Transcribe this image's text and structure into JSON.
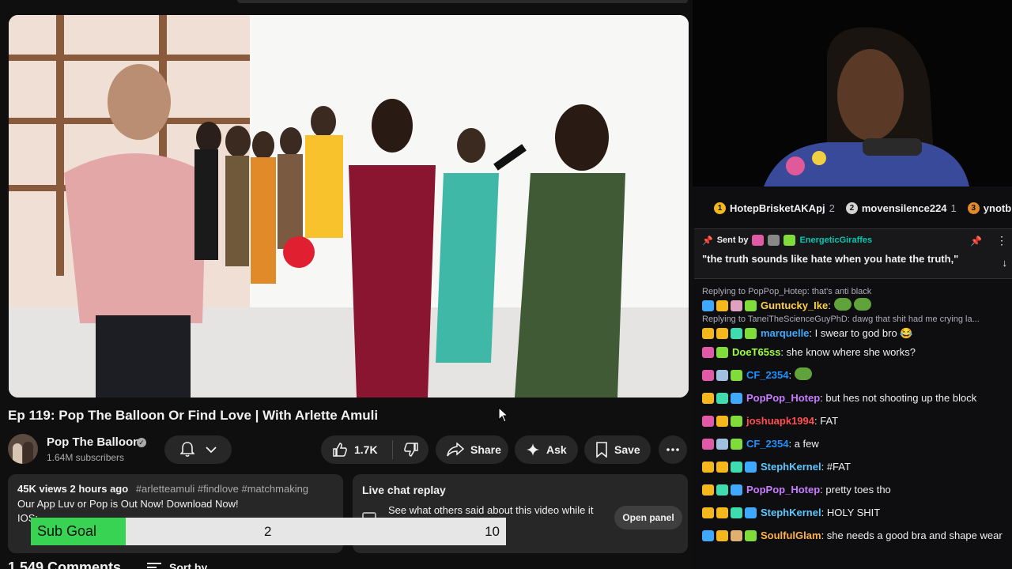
{
  "youtube": {
    "video_title": "Ep 119: Pop The Balloon Or Find Love | With Arlette Amuli",
    "channel": {
      "name": "Pop The Balloon",
      "subscribers": "1.64M subscribers"
    },
    "actions": {
      "likes": "1.7K",
      "share": "Share",
      "ask": "Ask",
      "save": "Save"
    },
    "description": {
      "views": "45K views",
      "age": "2 hours ago",
      "hashtags": "#arletteamuli #findlove #matchmaking",
      "line1": "Our App Luv or Pop is Out Now! Download Now!",
      "line2": "IOS:"
    },
    "live_chat_replay": {
      "title": "Live chat replay",
      "text": "See what others said about this video while it",
      "button": "Open panel"
    },
    "comments": {
      "count_label": "1,549 Comments",
      "sort_label": "Sort by"
    }
  },
  "sub_goal": {
    "label": "Sub Goal",
    "current": "2",
    "target": "10",
    "progress": 0.2
  },
  "twitch": {
    "top_gifters": [
      {
        "rank": "1",
        "name": "HotepBrisketAKApj",
        "count": "2",
        "color": "#f5b81c"
      },
      {
        "rank": "2",
        "name": "movensilence224",
        "count": "1",
        "color": "#d4d4d4"
      },
      {
        "rank": "3",
        "name": "ynotb",
        "count": "",
        "color": "#e08a2a"
      }
    ],
    "pinned": {
      "sent_by": "Sent by",
      "user": "EnergeticGiraffes",
      "message": "\"the truth sounds like hate when you hate the truth,\""
    },
    "chat": [
      {
        "reply": "Replying to PopPop_Hotep: that's anti black",
        "user": "Guntucky_Ike",
        "color": "#ffd23f",
        "text": "",
        "emotes": 2
      },
      {
        "reply": "Replying to TaneiTheScienceGuyPhD: dawg that shit had me crying la...",
        "user": "marquelle",
        "color": "#3fa9ff",
        "text": "I swear to god bro 😂"
      },
      {
        "user": "DoeT65ss",
        "color": "#9eff3f",
        "text": "she know where she works?"
      },
      {
        "user": "CF_2354",
        "color": "#1e90ff",
        "text": "",
        "emotes": 1
      },
      {
        "user": "PopPop_Hotep",
        "color": "#c77dff",
        "text": "but hes not shooting up the block"
      },
      {
        "user": "joshuapk1994",
        "color": "#ff4d4d",
        "text": "FAT"
      },
      {
        "user": "CF_2354",
        "color": "#1e90ff",
        "text": "a few"
      },
      {
        "user": "StephKernel",
        "color": "#5bc8ff",
        "text": "#FAT"
      },
      {
        "user": "PopPop_Hotep",
        "color": "#c77dff",
        "text": "pretty toes tho"
      },
      {
        "user": "StephKernel",
        "color": "#5bc8ff",
        "text": "HOLY SHIT"
      },
      {
        "user": "SoulfulGlam",
        "color": "#ffb347",
        "text": "she needs a good bra and shape wear"
      }
    ]
  }
}
